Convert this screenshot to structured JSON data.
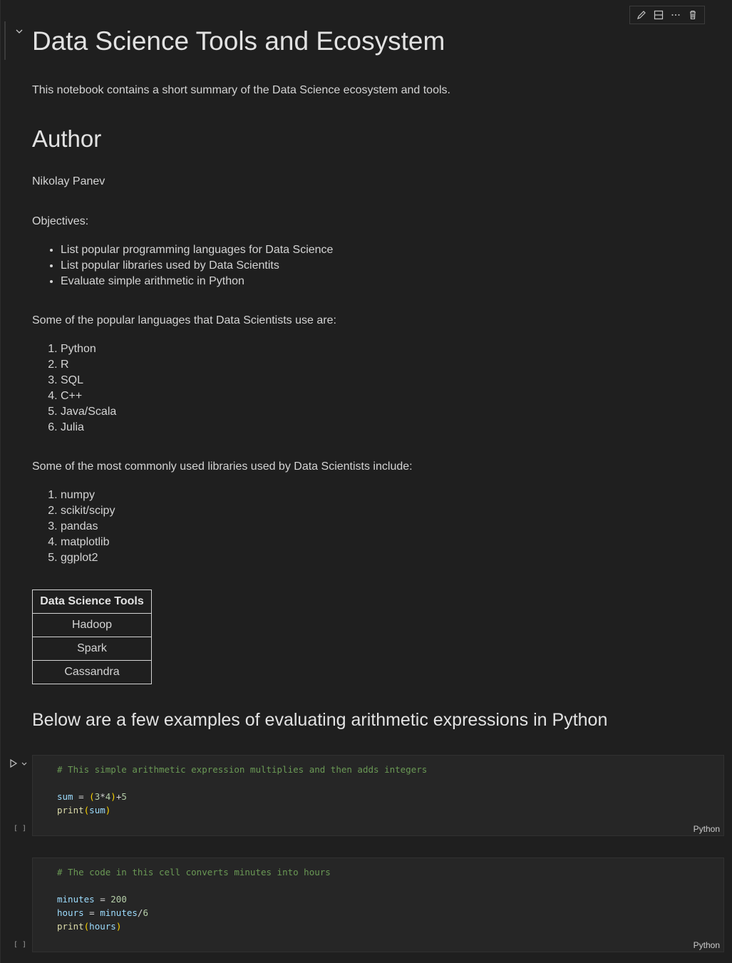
{
  "toolbar": {
    "icons": [
      "pencil-icon",
      "split-cell-icon",
      "more-icon",
      "trash-icon"
    ]
  },
  "markdown": {
    "title": "Data Science Tools and Ecosystem",
    "intro": "This notebook contains a short summary of the Data Science ecosystem and tools.",
    "author_heading": "Author",
    "author_name": "Nikolay Panev",
    "objectives_label": "Objectives:",
    "objectives": [
      "List popular programming languages for Data Science",
      "List popular libraries used by Data Scientits",
      "Evaluate simple arithmetic in Python"
    ],
    "languages_intro": "Some of the popular languages that Data Scientists use are:",
    "languages": [
      "Python",
      "R",
      "SQL",
      "C++",
      "Java/Scala",
      "Julia"
    ],
    "libraries_intro": "Some of the most commonly used libraries used by Data Scientists include:",
    "libraries": [
      "numpy",
      "scikit/scipy",
      "pandas",
      "matplotlib",
      "ggplot2"
    ],
    "tools_table": {
      "header": "Data Science Tools",
      "rows": [
        "Hadoop",
        "Spark",
        "Cassandra"
      ]
    },
    "examples_heading": "Below are a few examples of evaluating arithmetic expressions in Python"
  },
  "cells": [
    {
      "comment": "# This simple arithmetic expression multiplies and then adds integers",
      "line1_var": "sum",
      "line1_expr_num1": "3",
      "line1_expr_num2": "4",
      "line1_add": "5",
      "line2_fn": "print",
      "line2_arg": "sum",
      "exec_count": "[ ]",
      "language": "Python"
    },
    {
      "comment": "# The code in this cell converts minutes into hours",
      "line1_var": "minutes",
      "line1_val": "200",
      "line2_var": "hours",
      "line2_ref": "minutes",
      "line2_div": "6",
      "line3_fn": "print",
      "line3_arg": "hours",
      "exec_count": "[ ]",
      "language": "Python"
    }
  ]
}
